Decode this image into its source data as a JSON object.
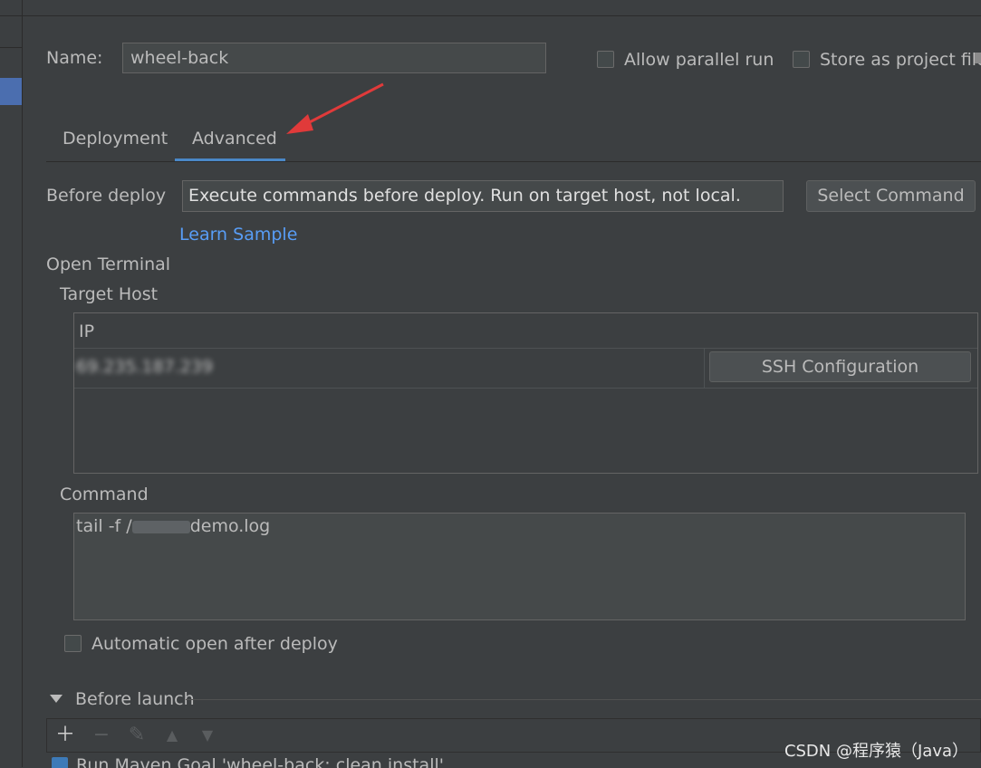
{
  "form": {
    "name_label": "Name:",
    "name_value": "wheel-back",
    "allow_parallel_label": "Allow parallel run",
    "store_project_label": "Store as project file"
  },
  "tabs": [
    {
      "label": "Deployment",
      "active": false
    },
    {
      "label": "Advanced",
      "active": true
    }
  ],
  "before_deploy": {
    "label": "Before deploy",
    "placeholder": "Execute commands before deploy. Run on target host, not local.",
    "select_button": "Select Command",
    "learn_link": "Learn Sample"
  },
  "terminal": {
    "section_label": "Open Terminal",
    "target_host_label": "Target Host",
    "table_header": "IP",
    "host_ip": "69.235.187.239",
    "ssh_button": "SSH Configuration",
    "command_label": "Command",
    "command_prefix": "tail -f /",
    "command_suffix": "demo.log",
    "auto_open_label": "Automatic open after deploy"
  },
  "before_launch": {
    "section_label": "Before launch",
    "task": "Run Maven Goal 'wheel-back: clean install'"
  },
  "watermark": "CSDN @程序猿（Java）",
  "colors": {
    "background": "#3c3f41",
    "accent": "#4a88c7",
    "link": "#589df6",
    "arrow": "#e03a3a"
  }
}
